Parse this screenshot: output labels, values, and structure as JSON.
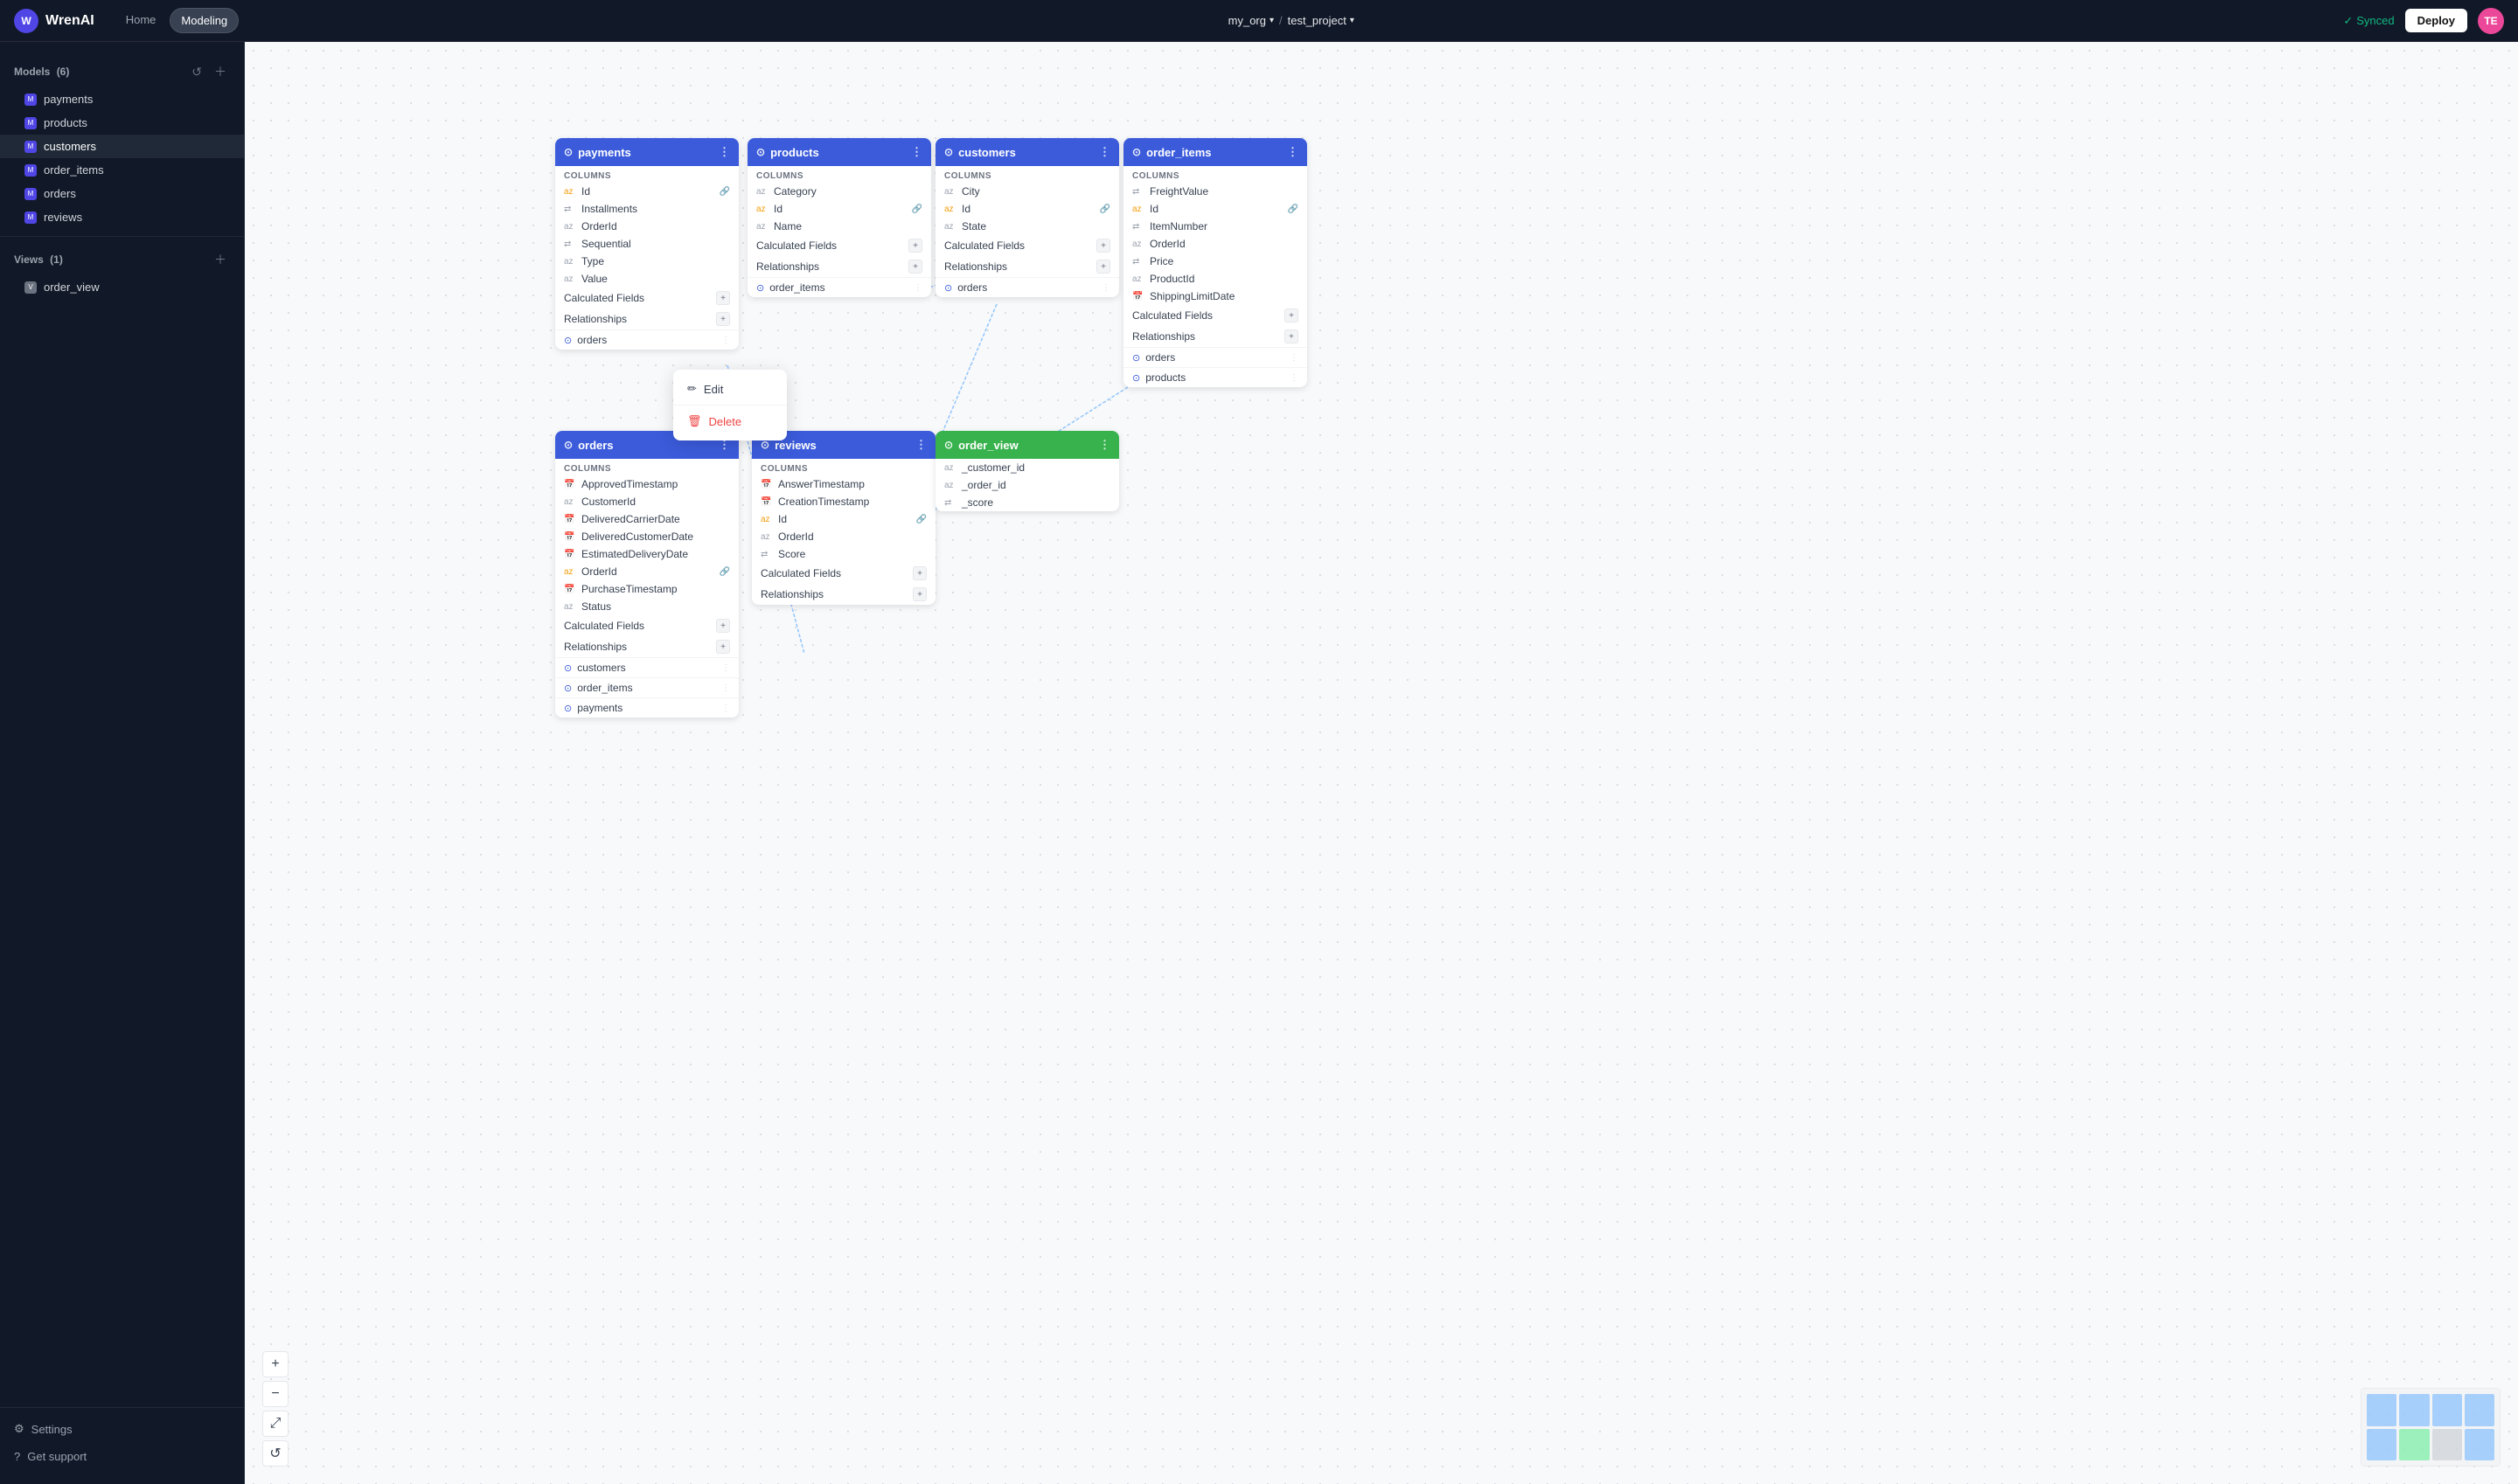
{
  "app": {
    "name": "WrenAI"
  },
  "nav": {
    "home_label": "Home",
    "modeling_label": "Modeling",
    "org": "my_org",
    "project": "test_project",
    "synced_label": "Synced",
    "deploy_label": "Deploy",
    "avatar_initials": "TE"
  },
  "sidebar": {
    "models_label": "Models",
    "models_count": "(6)",
    "views_label": "Views",
    "views_count": "(1)",
    "models": [
      {
        "id": "payments",
        "label": "payments"
      },
      {
        "id": "products",
        "label": "products"
      },
      {
        "id": "customers",
        "label": "customers",
        "selected": true
      },
      {
        "id": "order_items",
        "label": "order_items"
      },
      {
        "id": "orders",
        "label": "orders"
      },
      {
        "id": "reviews",
        "label": "reviews"
      }
    ],
    "views": [
      {
        "id": "order_view",
        "label": "order_view"
      }
    ],
    "settings_label": "Settings",
    "support_label": "Get support"
  },
  "cards": {
    "payments": {
      "title": "payments",
      "color": "blue",
      "columns_label": "Columns",
      "fields": [
        {
          "name": "Id",
          "type": "az",
          "key": true
        },
        {
          "name": "Installments",
          "type": "num"
        },
        {
          "name": "OrderId",
          "type": "az"
        },
        {
          "name": "Sequential",
          "type": "num"
        },
        {
          "name": "Type",
          "type": "az"
        },
        {
          "name": "Value",
          "type": "az"
        }
      ],
      "calculated_fields_label": "Calculated Fields",
      "relationships_label": "Relationships",
      "related": [
        {
          "name": "orders",
          "icon": "⊙"
        }
      ]
    },
    "products": {
      "title": "products",
      "color": "blue",
      "columns_label": "Columns",
      "fields": [
        {
          "name": "Category",
          "type": "az"
        },
        {
          "name": "Id",
          "type": "az",
          "key": true
        },
        {
          "name": "Name",
          "type": "az"
        }
      ],
      "calculated_fields_label": "Calculated Fields",
      "relationships_label": "Relationships",
      "related": [
        {
          "name": "order_items",
          "icon": "⊙"
        }
      ]
    },
    "customers": {
      "title": "customers",
      "color": "blue",
      "columns_label": "Columns",
      "fields": [
        {
          "name": "City",
          "type": "az"
        },
        {
          "name": "Id",
          "type": "az",
          "key": true
        },
        {
          "name": "State",
          "type": "az"
        }
      ],
      "calculated_fields_label": "Calculated Fields",
      "relationships_label": "Relationships",
      "related": [
        {
          "name": "orders",
          "icon": "⊙"
        }
      ]
    },
    "order_items": {
      "title": "order_items",
      "color": "blue",
      "columns_label": "Columns",
      "fields": [
        {
          "name": "FreightValue",
          "type": "num"
        },
        {
          "name": "Id",
          "type": "az",
          "key": true
        },
        {
          "name": "ItemNumber",
          "type": "num"
        },
        {
          "name": "OrderId",
          "type": "az"
        },
        {
          "name": "Price",
          "type": "num"
        },
        {
          "name": "ProductId",
          "type": "az"
        },
        {
          "name": "ShippingLimitDate",
          "type": "cal"
        }
      ],
      "calculated_fields_label": "Calculated Fields",
      "relationships_label": "Relationships",
      "related": [
        {
          "name": "orders",
          "icon": "⊙"
        },
        {
          "name": "products",
          "icon": "⊙"
        }
      ]
    },
    "orders": {
      "title": "orders",
      "color": "blue",
      "columns_label": "Columns",
      "fields": [
        {
          "name": "ApprovedTimestamp",
          "type": "cal"
        },
        {
          "name": "CustomerId",
          "type": "az"
        },
        {
          "name": "DeliveredCarrierDate",
          "type": "cal"
        },
        {
          "name": "DeliveredCustomerDate",
          "type": "cal"
        },
        {
          "name": "EstimatedDeliveryDate",
          "type": "cal"
        },
        {
          "name": "OrderId",
          "type": "az",
          "key": true
        },
        {
          "name": "PurchaseTimestamp",
          "type": "cal"
        },
        {
          "name": "Status",
          "type": "az"
        }
      ],
      "calculated_fields_label": "Calculated Fields",
      "relationships_label": "Relationships",
      "related": [
        {
          "name": "customers",
          "icon": "⊙"
        },
        {
          "name": "order_items",
          "icon": "⊙"
        },
        {
          "name": "payments",
          "icon": "⊙"
        }
      ]
    },
    "reviews": {
      "title": "reviews",
      "color": "blue",
      "columns_label": "Columns",
      "fields": [
        {
          "name": "AnswerTimestamp",
          "type": "cal"
        },
        {
          "name": "CreationTimestamp",
          "type": "cal"
        },
        {
          "name": "Id",
          "type": "az",
          "key": true
        },
        {
          "name": "OrderId",
          "type": "az"
        },
        {
          "name": "Score",
          "type": "num"
        }
      ],
      "calculated_fields_label": "Calculated Fields",
      "relationships_label": "Relationships"
    },
    "order_view": {
      "title": "order_view",
      "color": "green",
      "fields": [
        {
          "name": "_customer_id",
          "type": "az"
        },
        {
          "name": "_order_id",
          "type": "az"
        },
        {
          "name": "_score",
          "type": "num"
        }
      ]
    }
  },
  "context_menu": {
    "edit_label": "Edit",
    "delete_label": "Delete"
  },
  "canvas_controls": {
    "zoom_in": "+",
    "zoom_out": "−",
    "fit": "⤢",
    "refresh": "↺"
  }
}
